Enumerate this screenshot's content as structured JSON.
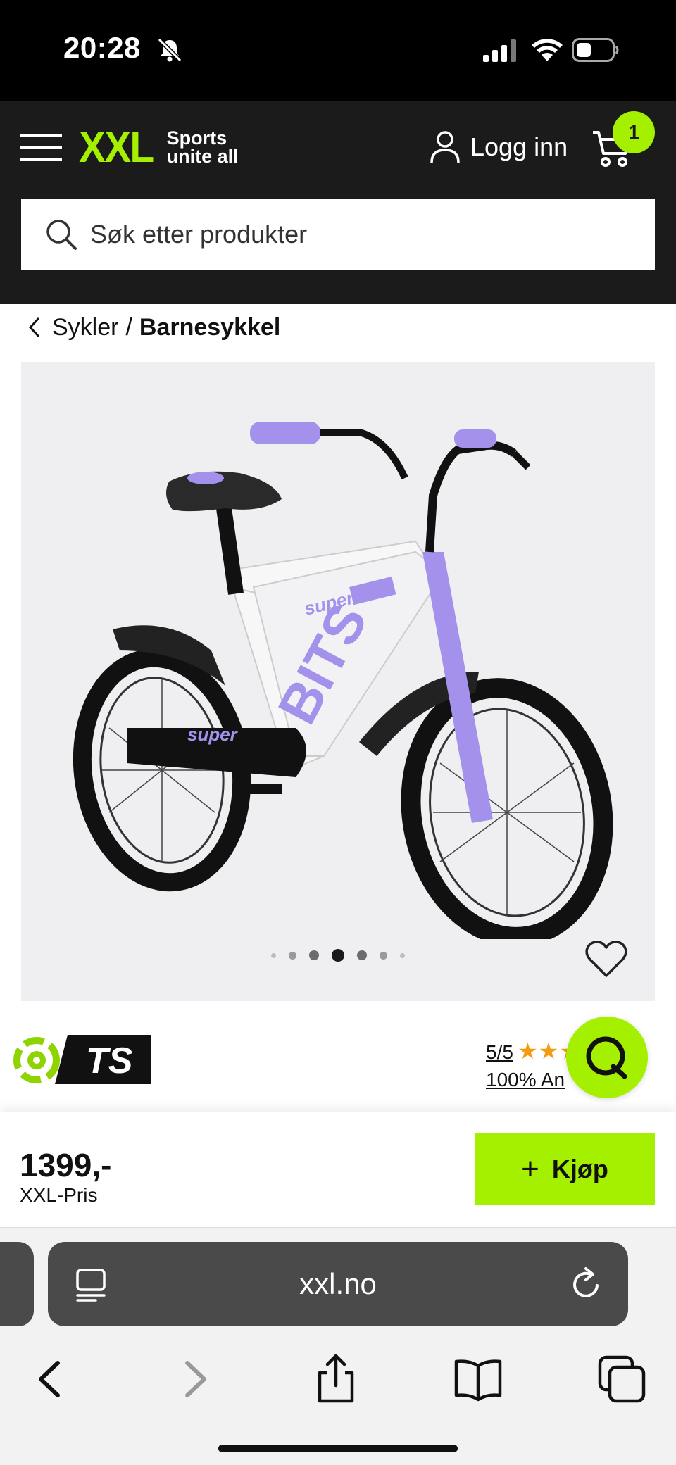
{
  "status_bar": {
    "time": "20:28"
  },
  "header": {
    "logo_text": "XXL",
    "logo_tagline_line1": "Sports",
    "logo_tagline_line2": "unite all",
    "login_label": "Logg inn",
    "cart_count": "1",
    "accent_color": "#a4f000"
  },
  "search": {
    "placeholder": "Søk etter produkter"
  },
  "breadcrumb": {
    "parent": "Sykler",
    "separator": "/",
    "current": "Barnesykkel"
  },
  "product": {
    "image_subject": "kids bike white violet",
    "carousel": {
      "total": 7,
      "active_index": 3
    },
    "brand_logo_text": "TS",
    "rating": {
      "score": "5/5",
      "stars": "★★★★★",
      "recommend_text": "100% An"
    }
  },
  "purchase": {
    "price": "1399,-",
    "price_label": "XXL-Pris",
    "buy_label": "Kjøp"
  },
  "browser": {
    "url": "xxl.no"
  }
}
